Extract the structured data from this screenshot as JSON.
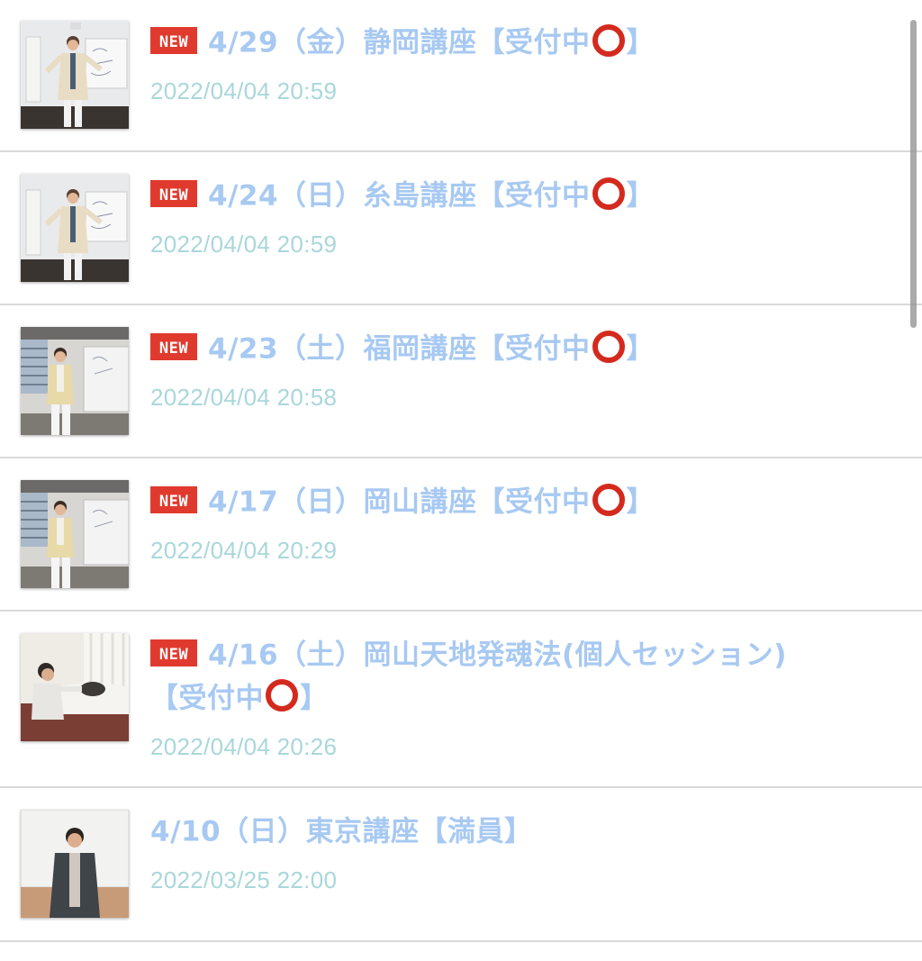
{
  "colors": {
    "title": "#a7c9f2",
    "date": "#a9d7db",
    "badge": "#e03a2e",
    "circle": "#d42a1e",
    "divider": "#d9d9d9"
  },
  "badge_label": "NEW",
  "items": [
    {
      "new": true,
      "title": "4/29（金）静岡講座【受付中",
      "suffix": "】",
      "circle": true,
      "date": "2022/04/04 20:59",
      "thumb": "seminar-man-whiteboard"
    },
    {
      "new": true,
      "title": "4/24（日）糸島講座【受付中",
      "suffix": "】",
      "circle": true,
      "date": "2022/04/04 20:59",
      "thumb": "seminar-man-whiteboard"
    },
    {
      "new": true,
      "title": "4/23（土）福岡講座【受付中",
      "suffix": "】",
      "circle": true,
      "date": "2022/04/04 20:58",
      "thumb": "seminar-man-window"
    },
    {
      "new": true,
      "title": "4/17（日）岡山講座【受付中",
      "suffix": "】",
      "circle": true,
      "date": "2022/04/04 20:29",
      "thumb": "seminar-man-window"
    },
    {
      "new": true,
      "title": "4/16（土）岡山天地発魂法(個人セッション)",
      "title2": "【受付中",
      "suffix": "】",
      "circle": true,
      "date": "2022/04/04 20:26",
      "thumb": "session-bed"
    },
    {
      "new": false,
      "title": "4/10（日）東京講座【満員】",
      "suffix": "",
      "circle": false,
      "date": "2022/03/25 22:00",
      "thumb": "man-dark-jacket"
    }
  ]
}
